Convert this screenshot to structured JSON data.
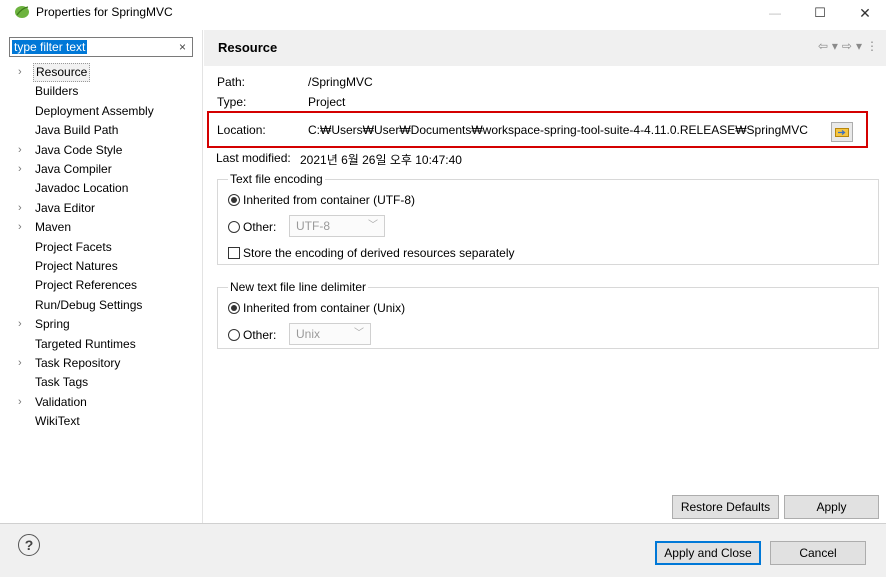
{
  "window": {
    "title": "Properties for SpringMVC",
    "min_glyph": "—",
    "max_glyph": "☐",
    "close_glyph": "✕"
  },
  "filter": {
    "value": "type filter text",
    "clear_glyph": "×"
  },
  "tree": {
    "items": [
      {
        "label": "Resource",
        "expandable": true,
        "selected": true
      },
      {
        "label": "Builders",
        "expandable": false
      },
      {
        "label": "Deployment Assembly",
        "expandable": false
      },
      {
        "label": "Java Build Path",
        "expandable": false
      },
      {
        "label": "Java Code Style",
        "expandable": true
      },
      {
        "label": "Java Compiler",
        "expandable": true
      },
      {
        "label": "Javadoc Location",
        "expandable": false
      },
      {
        "label": "Java Editor",
        "expandable": true
      },
      {
        "label": "Maven",
        "expandable": true
      },
      {
        "label": "Project Facets",
        "expandable": false
      },
      {
        "label": "Project Natures",
        "expandable": false
      },
      {
        "label": "Project References",
        "expandable": false
      },
      {
        "label": "Run/Debug Settings",
        "expandable": false
      },
      {
        "label": "Spring",
        "expandable": true
      },
      {
        "label": "Targeted Runtimes",
        "expandable": false
      },
      {
        "label": "Task Repository",
        "expandable": true
      },
      {
        "label": "Task Tags",
        "expandable": false
      },
      {
        "label": "Validation",
        "expandable": true
      },
      {
        "label": "WikiText",
        "expandable": false
      }
    ]
  },
  "resource": {
    "header": "Resource",
    "path_label": "Path:",
    "path_value": "/SpringMVC",
    "type_label": "Type:",
    "type_value": "Project",
    "location_label": "Location:",
    "location_value": "C:₩Users₩User₩Documents₩workspace-spring-tool-suite-4-4.11.0.RELEASE₩SpringMVC",
    "last_modified_label": "Last modified:",
    "last_modified_value": "2021년 6월 26일 오후 10:47:40"
  },
  "encoding": {
    "group_title": "Text file encoding",
    "inherited_label": "Inherited from container (UTF-8)",
    "other_label": "Other:",
    "other_value": "UTF-8",
    "store_label": "Store the encoding of derived resources separately"
  },
  "delimiter": {
    "group_title": "New text file line delimiter",
    "inherited_label": "Inherited from container (Unix)",
    "other_label": "Other:",
    "other_value": "Unix"
  },
  "buttons": {
    "restore_defaults": "Restore Defaults",
    "apply": "Apply",
    "apply_and_close": "Apply and Close",
    "cancel": "Cancel",
    "help": "?"
  },
  "colors": {
    "selection": "#0078d7",
    "highlight_border": "#d40000"
  }
}
